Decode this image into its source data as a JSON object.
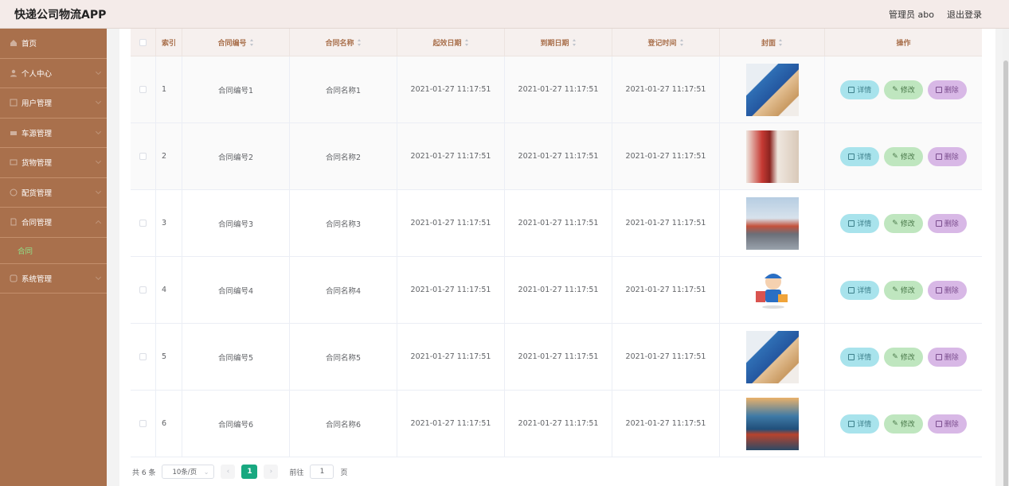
{
  "app_title": "快递公司物流APP",
  "header": {
    "user_label": "管理员 abo",
    "logout_label": "退出登录"
  },
  "sidebar": {
    "items": [
      {
        "label": "首页",
        "icon": "home-icon"
      },
      {
        "label": "个人中心",
        "icon": "user-icon"
      },
      {
        "label": "用户管理",
        "icon": "users-icon"
      },
      {
        "label": "车源管理",
        "icon": "truck-icon"
      },
      {
        "label": "货物管理",
        "icon": "box-icon"
      },
      {
        "label": "配货管理",
        "icon": "dispatch-icon"
      },
      {
        "label": "合同管理",
        "icon": "contract-icon"
      }
    ],
    "sub_item": "合同",
    "last_item": {
      "label": "系统管理",
      "icon": "system-icon"
    }
  },
  "table": {
    "headers": [
      "索引",
      "合同编号",
      "合同名称",
      "起效日期",
      "到期日期",
      "登记时间",
      "封面",
      "操作"
    ],
    "rows": [
      {
        "index": "1",
        "code": "合同编号1",
        "name": "合同名称1",
        "start": "2021-01-27 11:17:51",
        "end": "2021-01-27 11:17:51",
        "reg": "2021-01-27 11:17:51",
        "cover": "courier-handing-box"
      },
      {
        "index": "2",
        "code": "合同编号2",
        "name": "合同名称2",
        "start": "2021-01-27 11:17:51",
        "end": "2021-01-27 11:17:51",
        "reg": "2021-01-27 11:17:51",
        "cover": "courier-with-backpack"
      },
      {
        "index": "3",
        "code": "合同编号3",
        "name": "合同名称3",
        "start": "2021-01-27 11:17:51",
        "end": "2021-01-27 11:17:51",
        "reg": "2021-01-27 11:17:51",
        "cover": "truck-on-highway"
      },
      {
        "index": "4",
        "code": "合同编号4",
        "name": "合同名称4",
        "start": "2021-01-27 11:17:51",
        "end": "2021-01-27 11:17:51",
        "reg": "2021-01-27 11:17:51",
        "cover": "cartoon-delivery-boy"
      },
      {
        "index": "5",
        "code": "合同编号5",
        "name": "合同名称5",
        "start": "2021-01-27 11:17:51",
        "end": "2021-01-27 11:17:51",
        "reg": "2021-01-27 11:17:51",
        "cover": "courier-handing-box"
      },
      {
        "index": "6",
        "code": "合同编号6",
        "name": "合同名称6",
        "start": "2021-01-27 11:17:51",
        "end": "2021-01-27 11:17:51",
        "reg": "2021-01-27 11:17:51",
        "cover": "plane-over-port"
      }
    ],
    "actions": {
      "detail": "详情",
      "edit": "修改",
      "delete": "删除"
    }
  },
  "pager": {
    "total": "共 6 条",
    "page_size": "10条/页",
    "current_page": "1",
    "goto_label": "前往",
    "goto_value": "1",
    "page_suffix": "页"
  },
  "colors": {
    "sidebar": "#a9704c",
    "accent": "#18a880",
    "header_text": "#a9704c"
  }
}
